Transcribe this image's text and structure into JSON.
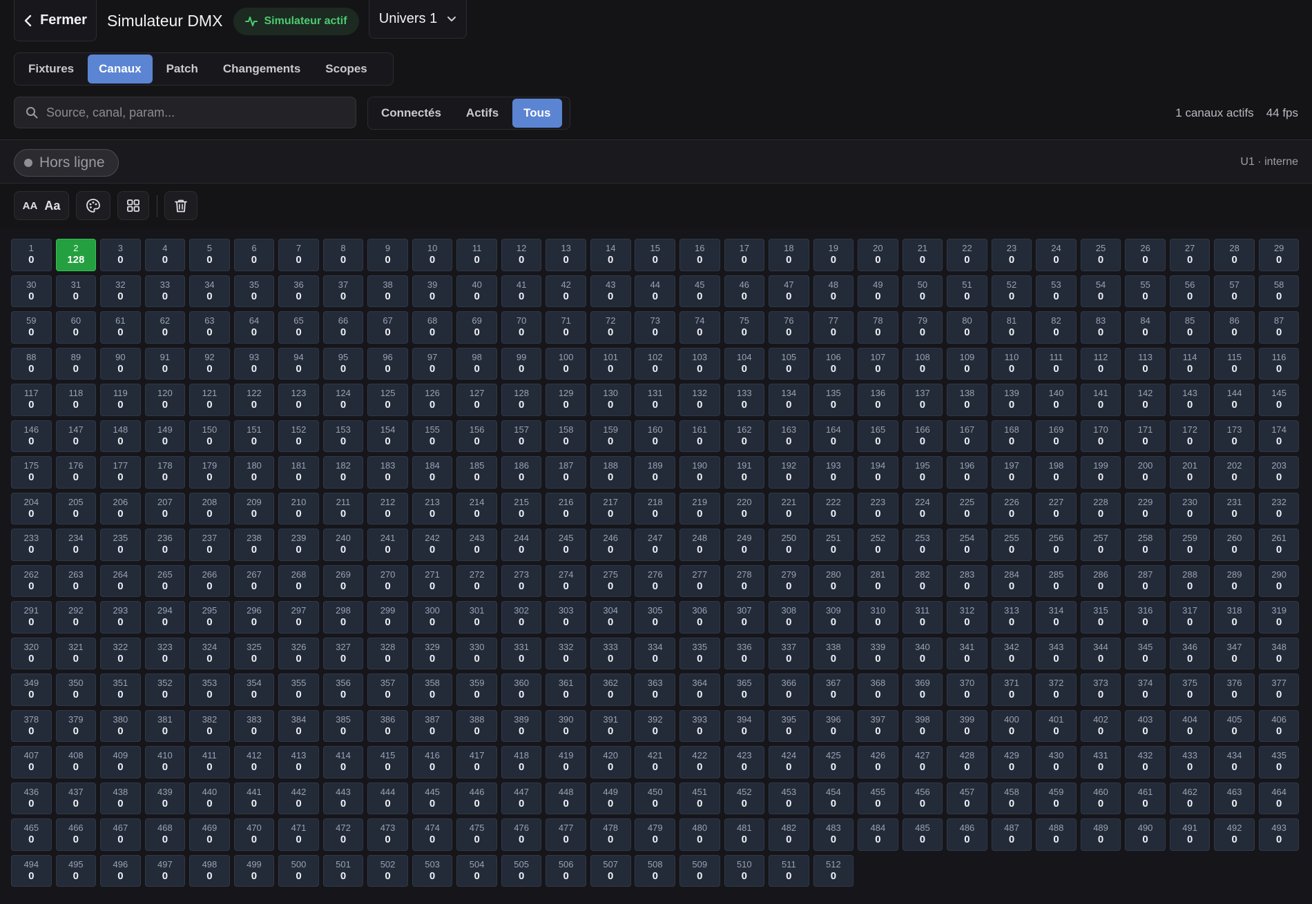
{
  "header": {
    "close_label": "Fermer",
    "title": "Simulateur DMX",
    "status_badge": "Simulateur actif",
    "universe_select": "Univers 1"
  },
  "tabs": [
    {
      "label": "Fixtures",
      "active": false
    },
    {
      "label": "Canaux",
      "active": true
    },
    {
      "label": "Patch",
      "active": false
    },
    {
      "label": "Changements",
      "active": false
    },
    {
      "label": "Scopes",
      "active": false
    }
  ],
  "search": {
    "placeholder": "Source, canal, param..."
  },
  "filters": [
    {
      "label": "Connectés",
      "active": false
    },
    {
      "label": "Actifs",
      "active": false
    },
    {
      "label": "Tous",
      "active": true
    }
  ],
  "stats": {
    "active_channels": "1 canaux actifs",
    "fps": "44 fps"
  },
  "connection": {
    "status": "Hors ligne",
    "universe_info": "U1 · interne"
  },
  "toolbar": {
    "font_small": "AA",
    "font_large": "Aa"
  },
  "icons": {
    "close": "chevron-left-icon",
    "status": "activity-icon",
    "universe": "chevron-down-icon",
    "search": "search-icon",
    "palette": "palette-icon",
    "grid": "grid-icon",
    "trash": "trash-icon"
  },
  "colors": {
    "accent": "#5b85d3",
    "active_channel": "#24a040",
    "status_green": "#4ccb70",
    "background": "#141417"
  },
  "channels": {
    "count": 512,
    "default_value": 0,
    "values": {
      "2": 128
    }
  }
}
